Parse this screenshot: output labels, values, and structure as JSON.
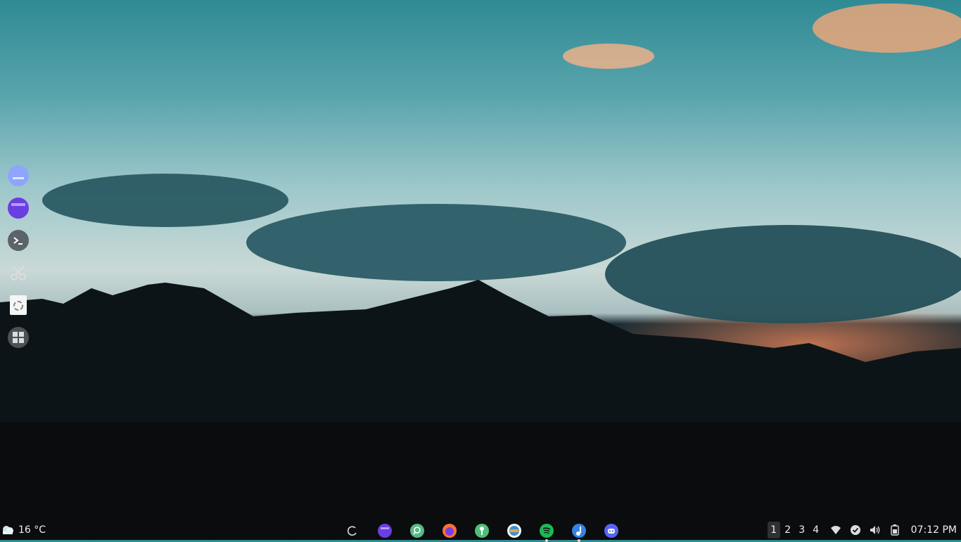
{
  "wallpaper": {
    "description_free": true,
    "colors": {
      "sky_top": "#2f8a94",
      "sky_mid": "#c9d9d6",
      "sunset": "#f68c5f",
      "ground": "#07090b"
    }
  },
  "left_dock": {
    "items": [
      {
        "icon": "dolphin-files-icon"
      },
      {
        "icon": "folder-icon"
      },
      {
        "icon": "terminal-icon"
      },
      {
        "icon": "scissors-icon"
      },
      {
        "icon": "recycle-bin-icon"
      },
      {
        "icon": "app-grid-icon"
      }
    ]
  },
  "weather": {
    "icon": "weather-cloud-icon",
    "temperature": "16 °C"
  },
  "taskbar": {
    "apps": [
      {
        "icon": "debian-swirl-icon"
      },
      {
        "icon": "files-icon"
      },
      {
        "icon": "search-icon"
      },
      {
        "icon": "firefox-icon"
      },
      {
        "icon": "pin-icon"
      },
      {
        "icon": "lutris-icon"
      },
      {
        "icon": "spotify-icon"
      },
      {
        "icon": "music-note-icon"
      },
      {
        "icon": "discord-icon"
      }
    ]
  },
  "tray": {
    "workspaces": [
      "1",
      "2",
      "3",
      "4"
    ],
    "active_workspace": "1",
    "icons": [
      "wifi-icon",
      "check-circle-icon",
      "volume-icon",
      "battery-icon"
    ],
    "clock": "07:12 PM"
  }
}
